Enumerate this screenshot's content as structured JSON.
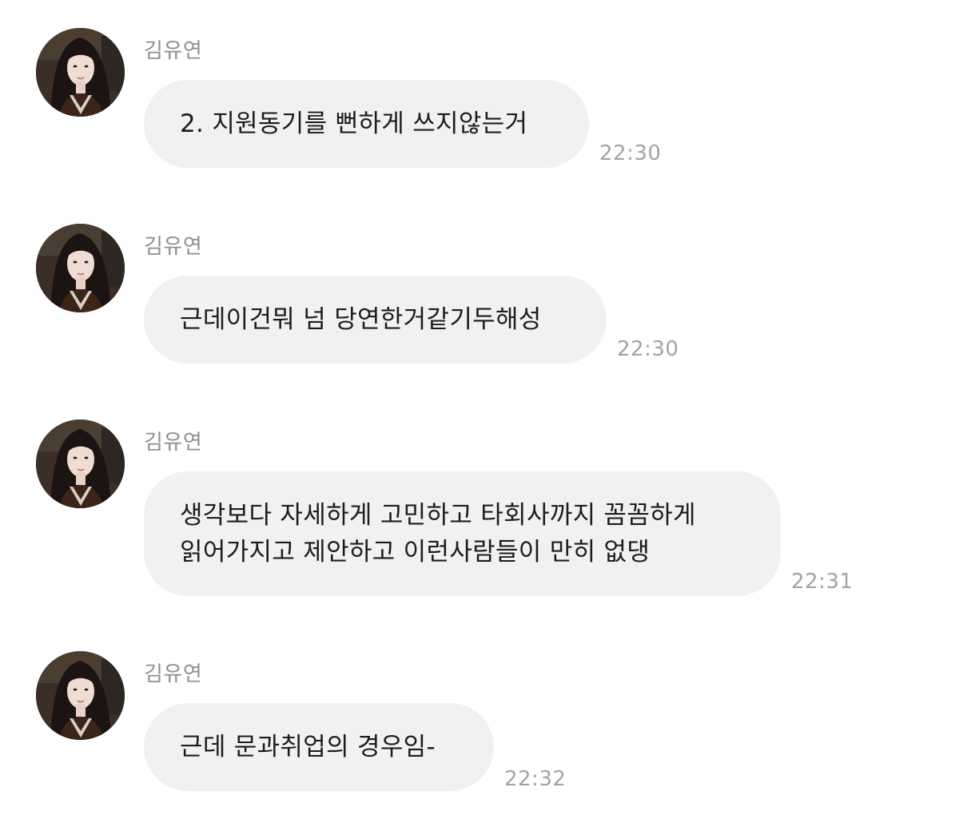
{
  "messages": [
    {
      "sender": "김유연",
      "text": "2. 지원동기를 뻔하게 쓰지않는거",
      "time": "22:30"
    },
    {
      "sender": "김유연",
      "text": "근데이건뭐 넘 당연한거같기두해성",
      "time": "22:30"
    },
    {
      "sender": "김유연",
      "text": "생각보다 자세하게 고민하고 타회사까지 꼼꼼하게\n읽어가지고 제안하고 이런사람들이 만히 없댕",
      "time": "22:31"
    },
    {
      "sender": "김유연",
      "text": "근데 문과취업의 경우임-",
      "time": "22:32"
    }
  ],
  "icons": {
    "avatar": "profile-photo-avatar-icon"
  },
  "colors": {
    "bubble": "#f1f1f3",
    "sender": "#8e8e93",
    "time": "#a3a3a8",
    "text": "#1c1c1e"
  }
}
